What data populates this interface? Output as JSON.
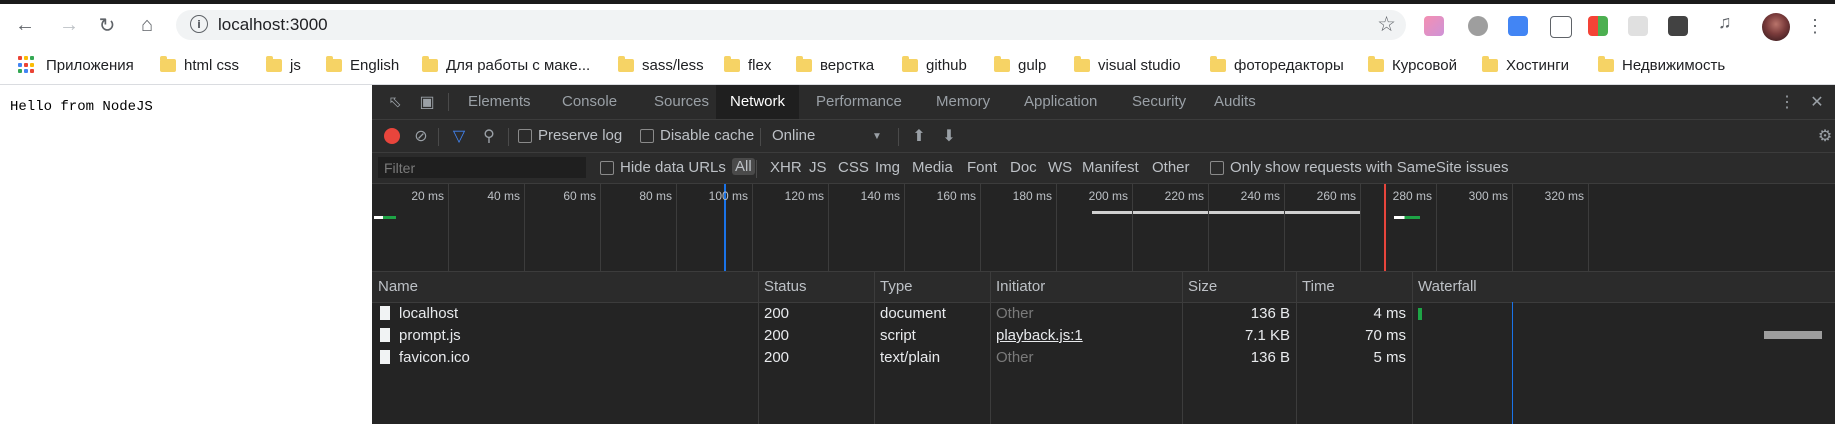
{
  "browser": {
    "url": "localhost:3000",
    "nav": {
      "back": "back-arrow-icon",
      "forward": "forward-arrow-icon",
      "reload": "reload-icon",
      "home": "home-icon"
    }
  },
  "bookmarks": {
    "apps_label": "Приложения",
    "items": [
      {
        "label": "html css"
      },
      {
        "label": "js"
      },
      {
        "label": "English"
      },
      {
        "label": "Для работы с маке..."
      },
      {
        "label": "sass/less"
      },
      {
        "label": "flex"
      },
      {
        "label": "верстка"
      },
      {
        "label": "github"
      },
      {
        "label": "gulp"
      },
      {
        "label": "visual studio"
      },
      {
        "label": "фоторедакторы"
      },
      {
        "label": "Курсовой"
      },
      {
        "label": "Хостинги"
      },
      {
        "label": "Недвижимость"
      }
    ]
  },
  "page": {
    "text": "Hello from NodeJS"
  },
  "devtools": {
    "tabs": [
      {
        "label": "Elements",
        "active": false
      },
      {
        "label": "Console",
        "active": false
      },
      {
        "label": "Sources",
        "active": false
      },
      {
        "label": "Network",
        "active": true
      },
      {
        "label": "Performance",
        "active": false
      },
      {
        "label": "Memory",
        "active": false
      },
      {
        "label": "Application",
        "active": false
      },
      {
        "label": "Security",
        "active": false
      },
      {
        "label": "Audits",
        "active": false
      }
    ],
    "toolbar": {
      "preserve_log": "Preserve log",
      "disable_cache": "Disable cache",
      "throttling": "Online"
    },
    "filter": {
      "placeholder": "Filter",
      "hide_data_urls": "Hide data URLs",
      "types": [
        "All",
        "XHR",
        "JS",
        "CSS",
        "Img",
        "Media",
        "Font",
        "Doc",
        "WS",
        "Manifest",
        "Other"
      ],
      "samesite": "Only show requests with SameSite issues"
    },
    "overview_ticks": [
      "20 ms",
      "40 ms",
      "60 ms",
      "80 ms",
      "100 ms",
      "120 ms",
      "140 ms",
      "160 ms",
      "180 ms",
      "200 ms",
      "220 ms",
      "240 ms",
      "260 ms",
      "280 ms",
      "300 ms",
      "320 ms"
    ],
    "columns": [
      "Name",
      "Status",
      "Type",
      "Initiator",
      "Size",
      "Time",
      "Waterfall"
    ],
    "rows": [
      {
        "name": "localhost",
        "status": "200",
        "type": "document",
        "initiator": "Other",
        "size": "136 B",
        "time": "4 ms"
      },
      {
        "name": "prompt.js",
        "status": "200",
        "type": "script",
        "initiator": "playback.js:1",
        "size": "7.1 KB",
        "time": "70 ms"
      },
      {
        "name": "favicon.ico",
        "status": "200",
        "type": "text/plain",
        "initiator": "Other",
        "size": "136 B",
        "time": "5 ms"
      }
    ],
    "colors": {
      "record": "#e8453c",
      "accent": "#4285f4"
    }
  }
}
